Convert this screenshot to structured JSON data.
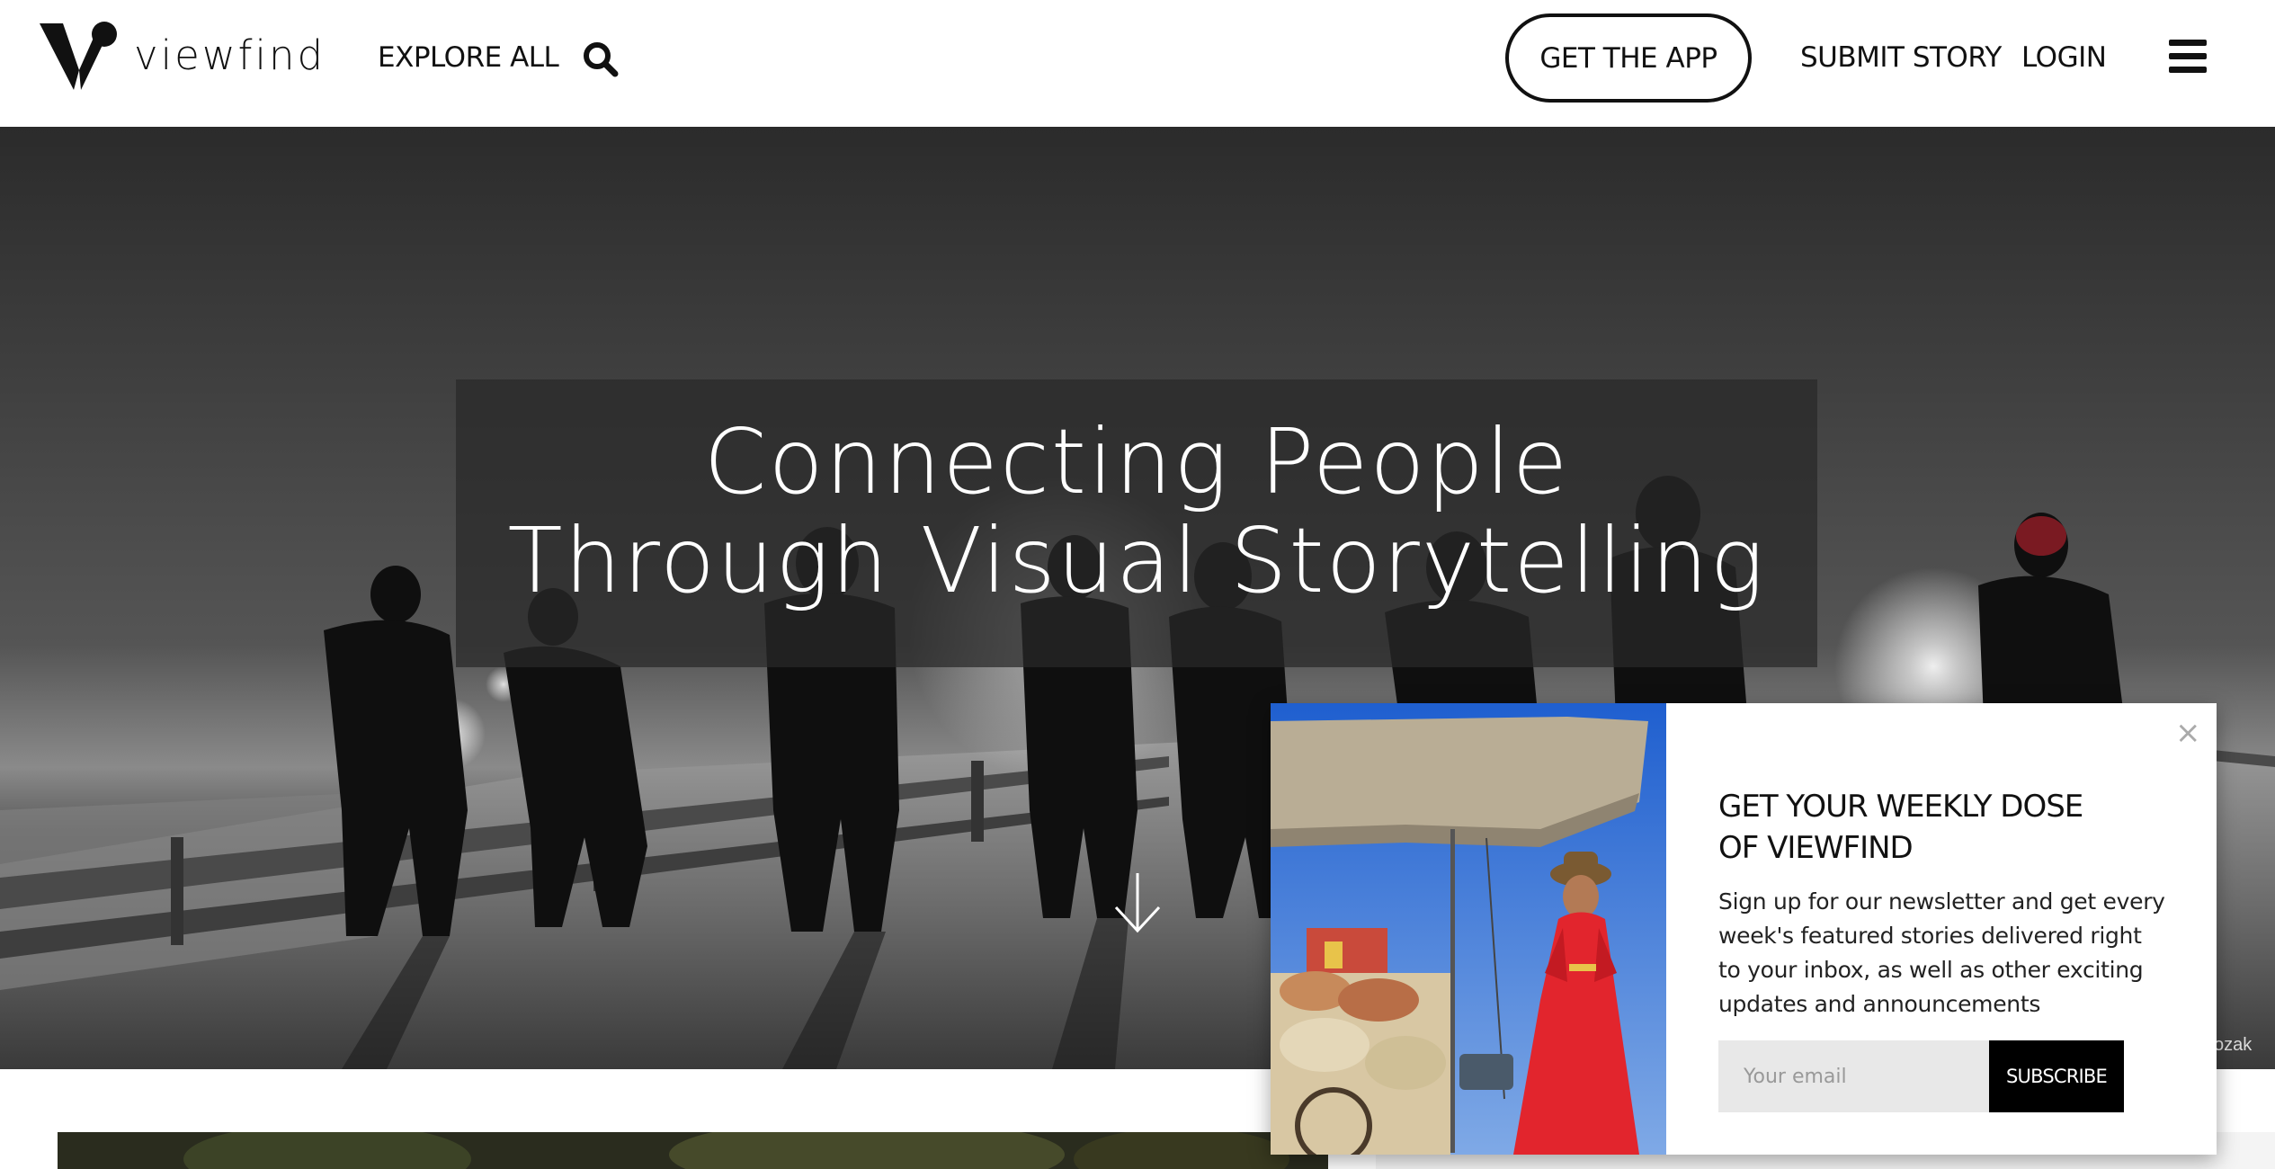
{
  "header": {
    "brand": "viewfind",
    "nav": {
      "explore": "EXPLORE ALL",
      "get_app": "GET THE APP",
      "submit": "SUBMIT STORY",
      "login": "LOGIN"
    },
    "icons": [
      "viewfind-logo-icon",
      "search-icon",
      "hamburger-menu-icon"
    ]
  },
  "hero": {
    "headline_line1": "Connecting People",
    "headline_line2": "Through Visual Storytelling",
    "photo_credit": "ozak",
    "icons": [
      "scroll-down-arrow-icon"
    ]
  },
  "newsletter": {
    "title_line1": "GET YOUR WEEKLY DOSE",
    "title_line2": "OF VIEWFIND",
    "body": "Sign up for our newsletter and get every week's featured stories delivered right to your inbox, as well as other exciting updates and announcements",
    "email_placeholder": "Your email",
    "subscribe_label": "SUBSCRIBE",
    "close_label": "×"
  }
}
